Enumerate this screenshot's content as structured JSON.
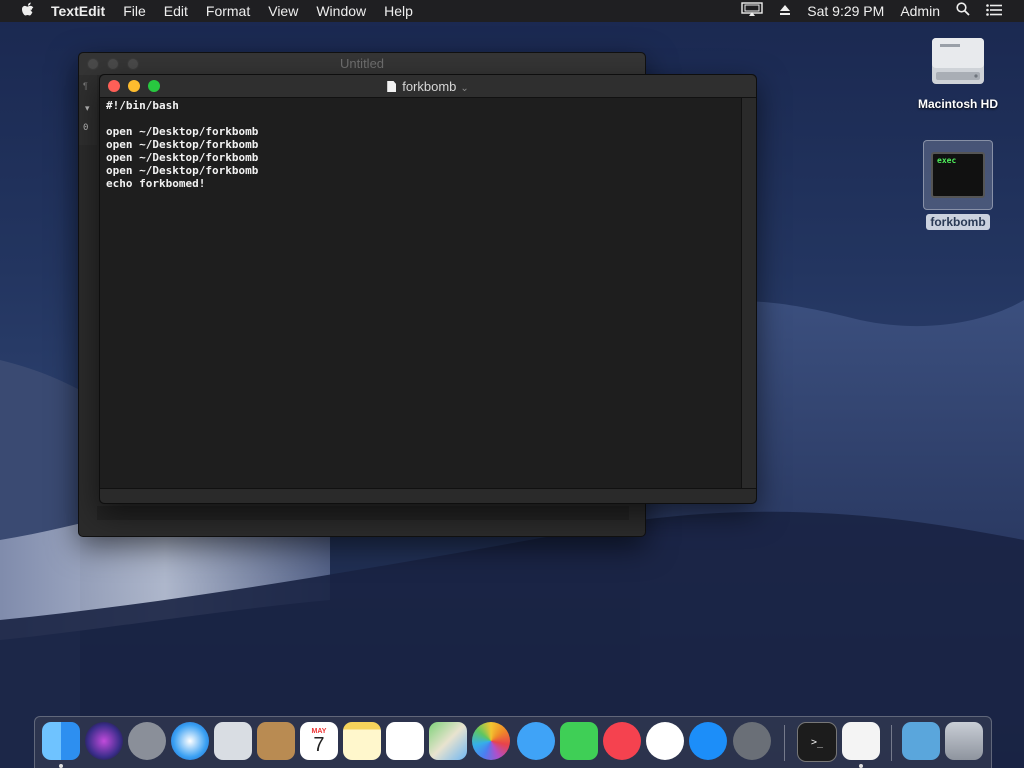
{
  "menubar": {
    "apple_icon": "apple-logo-icon",
    "app_name": "TextEdit",
    "menus": [
      "File",
      "Edit",
      "Format",
      "View",
      "Window",
      "Help"
    ],
    "status": {
      "display_icon": "airplay-display-icon",
      "eject_icon": "eject-icon",
      "datetime": "Sat 9:29 PM",
      "user": "Admin",
      "search_icon": "spotlight-search-icon",
      "notifications_icon": "notification-center-icon"
    }
  },
  "desktop": {
    "hd_label": "Macintosh HD",
    "exec_label": "forkbomb",
    "exec_badge": "exec"
  },
  "windows": {
    "back": {
      "title": "Untitled",
      "ruler_value": "0"
    },
    "front": {
      "title": "forkbomb",
      "content": "#!/bin/bash\n\nopen ~/Desktop/forkbomb\nopen ~/Desktop/forkbomb\nopen ~/Desktop/forkbomb\nopen ~/Desktop/forkbomb\necho forkbomed!"
    }
  },
  "colors": {
    "close": "#fe5f57",
    "minimize": "#febc2e",
    "zoom": "#28c840"
  },
  "dock": {
    "items": [
      {
        "name": "finder",
        "icon": "finder-icon",
        "running": true
      },
      {
        "name": "siri",
        "icon": "siri-icon",
        "running": false
      },
      {
        "name": "launchpad",
        "icon": "launchpad-rocket-icon",
        "running": false
      },
      {
        "name": "safari",
        "icon": "safari-compass-icon",
        "running": false
      },
      {
        "name": "mail",
        "icon": "mail-stamp-icon",
        "running": false
      },
      {
        "name": "contacts",
        "icon": "contacts-book-icon",
        "running": false
      },
      {
        "name": "calendar",
        "icon": "calendar-icon",
        "running": false,
        "month": "MAY",
        "day": "7"
      },
      {
        "name": "notes",
        "icon": "notes-icon",
        "running": false
      },
      {
        "name": "reminders",
        "icon": "reminders-icon",
        "running": false
      },
      {
        "name": "maps",
        "icon": "maps-icon",
        "running": false
      },
      {
        "name": "photos",
        "icon": "photos-flower-icon",
        "running": false
      },
      {
        "name": "messages",
        "icon": "messages-bubble-icon",
        "running": false
      },
      {
        "name": "facetime",
        "icon": "facetime-camera-icon",
        "running": false
      },
      {
        "name": "news",
        "icon": "news-icon",
        "running": false
      },
      {
        "name": "music",
        "icon": "itunes-music-icon",
        "running": false
      },
      {
        "name": "app-store",
        "icon": "app-store-icon",
        "running": false
      },
      {
        "name": "system-preferences",
        "icon": "system-preferences-gear-icon",
        "running": false
      },
      {
        "name": "terminal",
        "icon": "terminal-icon",
        "running": false,
        "glyph": ">_"
      },
      {
        "name": "textedit",
        "icon": "textedit-icon",
        "running": true
      },
      {
        "name": "downloads",
        "icon": "downloads-folder-icon",
        "running": false
      },
      {
        "name": "trash",
        "icon": "trash-icon",
        "running": false
      }
    ]
  }
}
